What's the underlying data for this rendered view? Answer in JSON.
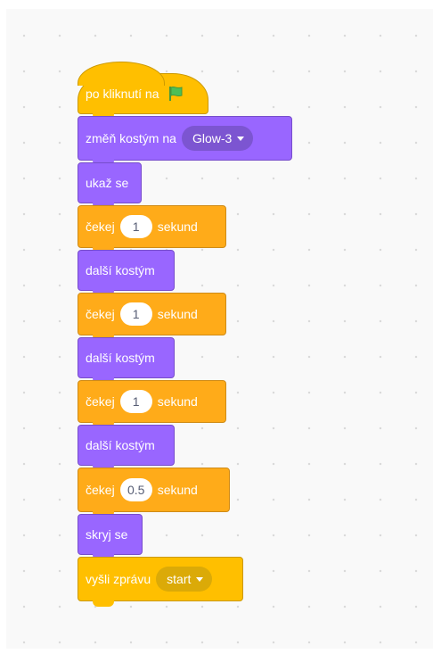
{
  "script": {
    "hat": {
      "label": "po kliknutí na",
      "icon": "green-flag-icon"
    },
    "switch_costume": {
      "label": "změň kostým na",
      "value": "Glow-3"
    },
    "show": {
      "label": "ukaž se"
    },
    "waits": [
      {
        "label": "čekej",
        "value": "1",
        "unit": "sekund"
      },
      {
        "label": "čekej",
        "value": "1",
        "unit": "sekund"
      },
      {
        "label": "čekej",
        "value": "1",
        "unit": "sekund"
      },
      {
        "label": "čekej",
        "value": "0.5",
        "unit": "sekund"
      }
    ],
    "next_costumes": [
      {
        "label": "další kostým"
      },
      {
        "label": "další kostým"
      },
      {
        "label": "další kostým"
      }
    ],
    "hide": {
      "label": "skryj se"
    },
    "broadcast": {
      "label": "vyšli zprávu",
      "value": "start"
    }
  },
  "colors": {
    "events": "#ffbf00",
    "looks": "#9966ff",
    "control": "#ffab19",
    "flag": "#4cbf56"
  }
}
